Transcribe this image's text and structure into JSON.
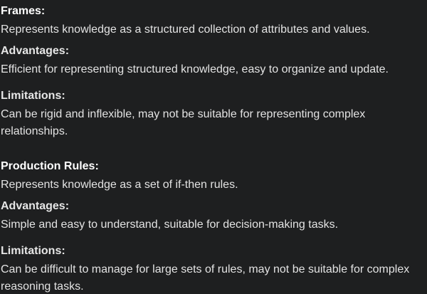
{
  "sections": [
    {
      "title": "Frames:",
      "description": "Represents knowledge as a structured collection of attributes and values.",
      "advantages_label": "Advantages:",
      "advantages_text": "Efficient for representing structured knowledge, easy to organize and update.",
      "limitations_label": "Limitations:",
      "limitations_text": "Can be rigid and inflexible, may not be suitable for representing complex relationships."
    },
    {
      "title": "Production Rules:",
      "description": "Represents knowledge as a set of if-then rules.",
      "advantages_label": "Advantages:",
      "advantages_text": "Simple and easy to understand, suitable for decision-making tasks.",
      "limitations_label": "Limitations:",
      "limitations_text": "Can be difficult to manage for large sets of rules, may not be suitable for complex reasoning tasks."
    }
  ]
}
